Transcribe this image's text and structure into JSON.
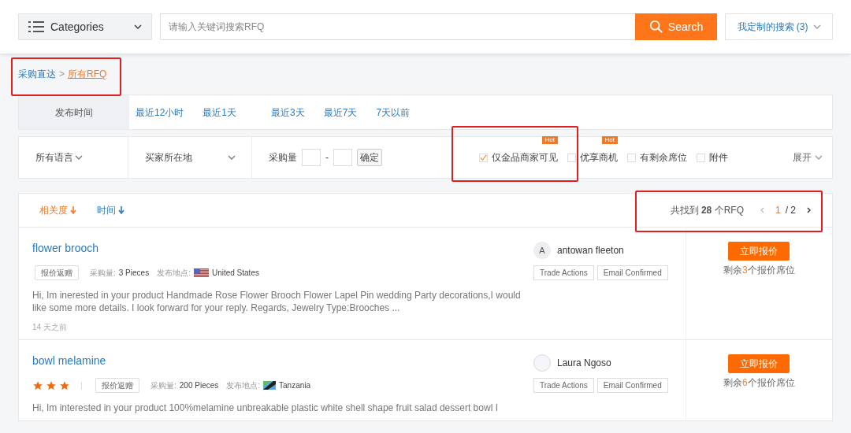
{
  "header": {
    "categories": "Categories",
    "search_placeholder": "请输入关键词搜索RFQ",
    "search_button": "Search",
    "saved_search": "我定制的搜索 (3)"
  },
  "breadcrumb": [
    {
      "label": "采购直达",
      "selected": false
    },
    {
      "label": "所有RFQ",
      "selected": true
    }
  ],
  "breadcrumb_separator": ">",
  "time_filter": {
    "label": "发布时间",
    "options": [
      "最近12小时",
      "最近1天",
      "最近3天",
      "最近7天",
      "7天以前"
    ]
  },
  "filters": {
    "language": "所有语言",
    "location": "买家所在地",
    "quantity_label": "采购量",
    "quantity_dash": "-",
    "confirm": "确定",
    "checkboxes": [
      {
        "label": "仅金品商家可见",
        "checked": true,
        "badge": "Hot"
      },
      {
        "label": "优享商机",
        "checked": false,
        "badge": "Hot"
      },
      {
        "label": "有剩余席位",
        "checked": false
      },
      {
        "label": "附件",
        "checked": false
      }
    ],
    "expand": "展开"
  },
  "sort": [
    {
      "label": "相关度",
      "selected": true
    },
    {
      "label": "时间",
      "selected": false
    }
  ],
  "results": {
    "summary": "共找到 **28** 个RFQ",
    "page": "1",
    "total": "/ 2"
  },
  "rows": [
    {
      "title": "flower brooch",
      "tag": "报价返赠",
      "quantity_label": "采购量:",
      "quantity": "3 Pieces",
      "location_label": "发布地点:",
      "country": "United States",
      "flag": {
        "kind": "us"
      },
      "description": "Hi, Im inerested in your product Handmade Rose Flower Brooch Flower Lapel Pin wedding Party decorations,I would like some more details. I look forward for your reply. Regards, Jewelry Type:Brooches ...",
      "time": "14 天之前",
      "buyer": "antowan fleeton",
      "avatar": "A",
      "badges": [
        "Trade Actions",
        "Email Confirmed"
      ],
      "action": "立即报价",
      "remaining_prefix": "剩余",
      "remaining": "3",
      "remaining_suffix": "个报价席位"
    },
    {
      "title": "bowl melamine",
      "stars": 3,
      "tag": "报价返赠",
      "quantity_label": "采购量:",
      "quantity": "200 Pieces",
      "location_label": "发布地点:",
      "country": "Tanzania",
      "flag": {
        "kind": "tz"
      },
      "description": "Hi, Im interested in your product 100%melamine unbreakable plastic white shell shape fruit salad dessert bowl I",
      "buyer": "Laura Ngoso",
      "badges": [
        "Trade Actions",
        "Email Confirmed"
      ],
      "action": "立即报价",
      "remaining_prefix": "剩余",
      "remaining": "6",
      "remaining_suffix": "个报价席位"
    }
  ]
}
